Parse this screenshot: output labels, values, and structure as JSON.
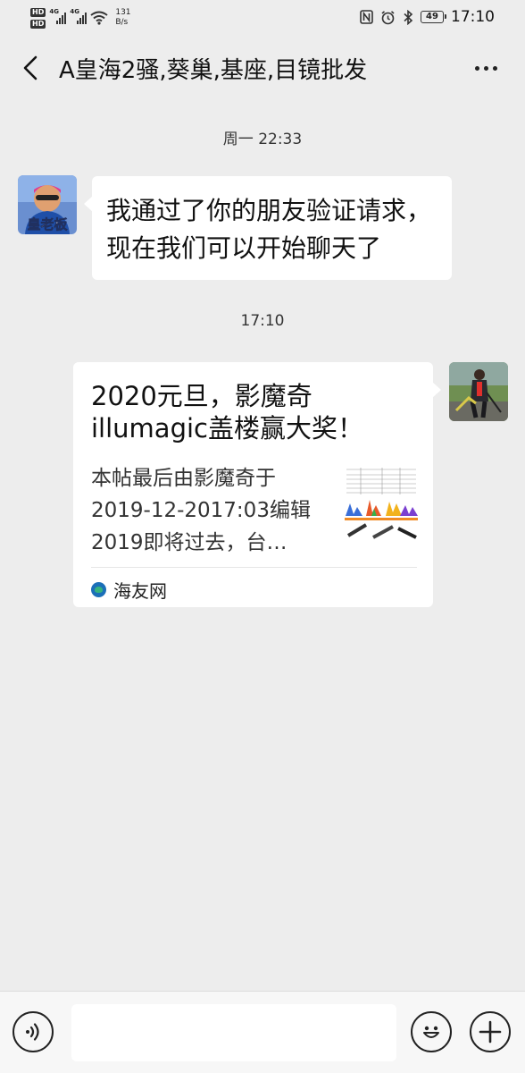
{
  "status_bar": {
    "hd_label_1": "HD",
    "hd_label_2": "HD",
    "signal1_gen": "4G",
    "signal2_gen": "4G",
    "net_speed_value": "131",
    "net_speed_unit": "B/s",
    "battery": "49",
    "time": "17:10"
  },
  "header": {
    "title": "A皇海2骚,葵巢,基座,目镜批发",
    "back_icon": "chevron-left-icon",
    "more_icon": "more-horizontal-icon"
  },
  "messages": [
    {
      "type": "timestamp",
      "text": "周一 22:33"
    },
    {
      "type": "text",
      "side": "left",
      "sender_avatar_caption": "皇老板",
      "text_line1": "我通过了你的朋友验证请求，",
      "text_line2": "现在我们可以开始聊天了"
    },
    {
      "type": "timestamp",
      "text": "17:10"
    },
    {
      "type": "link",
      "side": "right",
      "title": "2020元旦，影魔奇illumagic盖楼赢大奖！",
      "description_line1": "本帖最后由影魔奇于",
      "description_line2": "2019-12-2017:03编辑",
      "description_line3": "2019即将过去，台…",
      "source": "海友网"
    }
  ],
  "input_bar": {
    "voice_icon": "voice-icon",
    "emoji_icon": "emoji-icon",
    "plus_icon": "plus-icon",
    "input_value": ""
  }
}
